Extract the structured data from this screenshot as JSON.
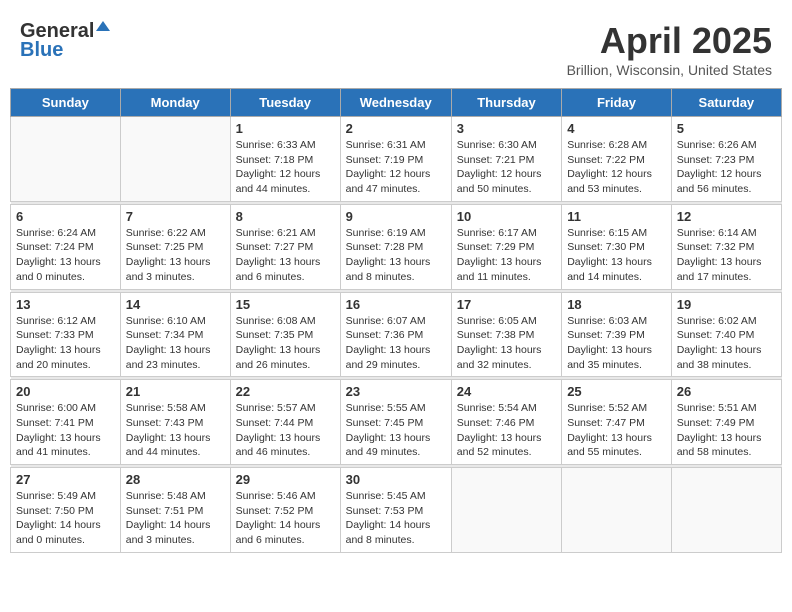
{
  "header": {
    "logo_general": "General",
    "logo_blue": "Blue",
    "month_title": "April 2025",
    "location": "Brillion, Wisconsin, United States"
  },
  "weekdays": [
    "Sunday",
    "Monday",
    "Tuesday",
    "Wednesday",
    "Thursday",
    "Friday",
    "Saturday"
  ],
  "weeks": [
    [
      {
        "day": "",
        "info": ""
      },
      {
        "day": "",
        "info": ""
      },
      {
        "day": "1",
        "info": "Sunrise: 6:33 AM\nSunset: 7:18 PM\nDaylight: 12 hours and 44 minutes."
      },
      {
        "day": "2",
        "info": "Sunrise: 6:31 AM\nSunset: 7:19 PM\nDaylight: 12 hours and 47 minutes."
      },
      {
        "day": "3",
        "info": "Sunrise: 6:30 AM\nSunset: 7:21 PM\nDaylight: 12 hours and 50 minutes."
      },
      {
        "day": "4",
        "info": "Sunrise: 6:28 AM\nSunset: 7:22 PM\nDaylight: 12 hours and 53 minutes."
      },
      {
        "day": "5",
        "info": "Sunrise: 6:26 AM\nSunset: 7:23 PM\nDaylight: 12 hours and 56 minutes."
      }
    ],
    [
      {
        "day": "6",
        "info": "Sunrise: 6:24 AM\nSunset: 7:24 PM\nDaylight: 13 hours and 0 minutes."
      },
      {
        "day": "7",
        "info": "Sunrise: 6:22 AM\nSunset: 7:25 PM\nDaylight: 13 hours and 3 minutes."
      },
      {
        "day": "8",
        "info": "Sunrise: 6:21 AM\nSunset: 7:27 PM\nDaylight: 13 hours and 6 minutes."
      },
      {
        "day": "9",
        "info": "Sunrise: 6:19 AM\nSunset: 7:28 PM\nDaylight: 13 hours and 8 minutes."
      },
      {
        "day": "10",
        "info": "Sunrise: 6:17 AM\nSunset: 7:29 PM\nDaylight: 13 hours and 11 minutes."
      },
      {
        "day": "11",
        "info": "Sunrise: 6:15 AM\nSunset: 7:30 PM\nDaylight: 13 hours and 14 minutes."
      },
      {
        "day": "12",
        "info": "Sunrise: 6:14 AM\nSunset: 7:32 PM\nDaylight: 13 hours and 17 minutes."
      }
    ],
    [
      {
        "day": "13",
        "info": "Sunrise: 6:12 AM\nSunset: 7:33 PM\nDaylight: 13 hours and 20 minutes."
      },
      {
        "day": "14",
        "info": "Sunrise: 6:10 AM\nSunset: 7:34 PM\nDaylight: 13 hours and 23 minutes."
      },
      {
        "day": "15",
        "info": "Sunrise: 6:08 AM\nSunset: 7:35 PM\nDaylight: 13 hours and 26 minutes."
      },
      {
        "day": "16",
        "info": "Sunrise: 6:07 AM\nSunset: 7:36 PM\nDaylight: 13 hours and 29 minutes."
      },
      {
        "day": "17",
        "info": "Sunrise: 6:05 AM\nSunset: 7:38 PM\nDaylight: 13 hours and 32 minutes."
      },
      {
        "day": "18",
        "info": "Sunrise: 6:03 AM\nSunset: 7:39 PM\nDaylight: 13 hours and 35 minutes."
      },
      {
        "day": "19",
        "info": "Sunrise: 6:02 AM\nSunset: 7:40 PM\nDaylight: 13 hours and 38 minutes."
      }
    ],
    [
      {
        "day": "20",
        "info": "Sunrise: 6:00 AM\nSunset: 7:41 PM\nDaylight: 13 hours and 41 minutes."
      },
      {
        "day": "21",
        "info": "Sunrise: 5:58 AM\nSunset: 7:43 PM\nDaylight: 13 hours and 44 minutes."
      },
      {
        "day": "22",
        "info": "Sunrise: 5:57 AM\nSunset: 7:44 PM\nDaylight: 13 hours and 46 minutes."
      },
      {
        "day": "23",
        "info": "Sunrise: 5:55 AM\nSunset: 7:45 PM\nDaylight: 13 hours and 49 minutes."
      },
      {
        "day": "24",
        "info": "Sunrise: 5:54 AM\nSunset: 7:46 PM\nDaylight: 13 hours and 52 minutes."
      },
      {
        "day": "25",
        "info": "Sunrise: 5:52 AM\nSunset: 7:47 PM\nDaylight: 13 hours and 55 minutes."
      },
      {
        "day": "26",
        "info": "Sunrise: 5:51 AM\nSunset: 7:49 PM\nDaylight: 13 hours and 58 minutes."
      }
    ],
    [
      {
        "day": "27",
        "info": "Sunrise: 5:49 AM\nSunset: 7:50 PM\nDaylight: 14 hours and 0 minutes."
      },
      {
        "day": "28",
        "info": "Sunrise: 5:48 AM\nSunset: 7:51 PM\nDaylight: 14 hours and 3 minutes."
      },
      {
        "day": "29",
        "info": "Sunrise: 5:46 AM\nSunset: 7:52 PM\nDaylight: 14 hours and 6 minutes."
      },
      {
        "day": "30",
        "info": "Sunrise: 5:45 AM\nSunset: 7:53 PM\nDaylight: 14 hours and 8 minutes."
      },
      {
        "day": "",
        "info": ""
      },
      {
        "day": "",
        "info": ""
      },
      {
        "day": "",
        "info": ""
      }
    ]
  ]
}
